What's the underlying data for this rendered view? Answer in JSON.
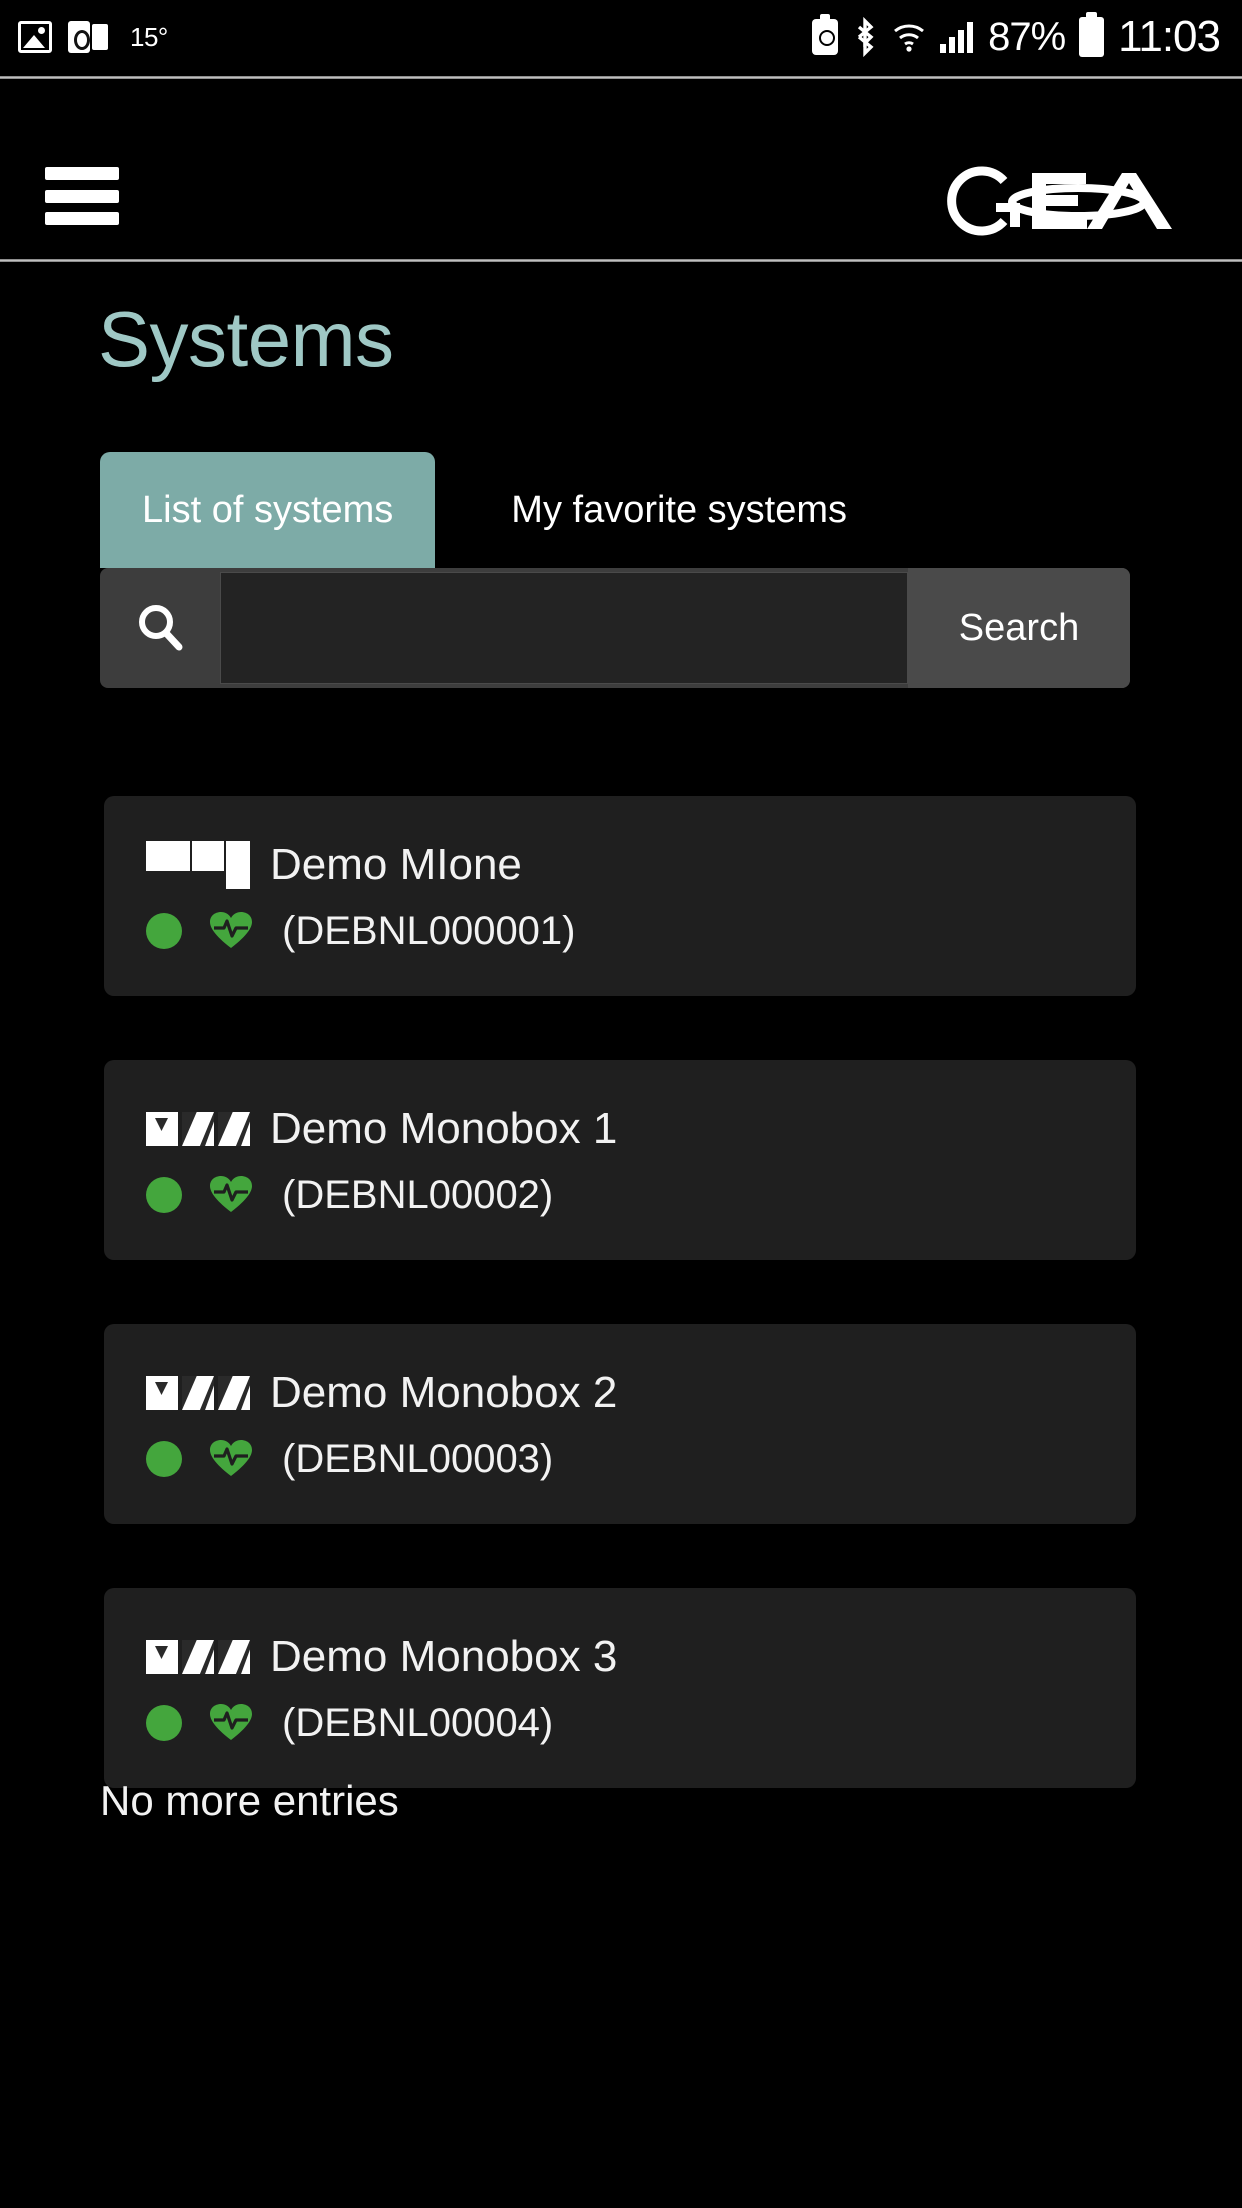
{
  "statusbar": {
    "temperature": "15°",
    "battery_percent": "87%",
    "clock": "11:03",
    "icons": {
      "photo": "photo-icon",
      "outlook": "outlook-icon",
      "battery_saver": "battery-saver-icon",
      "bluetooth": "bluetooth-icon",
      "wifi": "wifi-icon",
      "signal": "signal-bars-icon",
      "battery": "battery-icon"
    }
  },
  "appbar": {
    "menu_label": "menu",
    "logo_text": "GEA"
  },
  "page": {
    "title": "Systems"
  },
  "tabs": [
    {
      "label": "List of systems",
      "active": true
    },
    {
      "label": "My favorite systems",
      "active": false
    }
  ],
  "search": {
    "icon": "search-icon",
    "value": "",
    "placeholder": "",
    "button_label": "Search"
  },
  "systems": [
    {
      "name": "Demo MIone",
      "code": "(DEBNL000001)",
      "device_type": "mione",
      "status": "online",
      "health": "ok"
    },
    {
      "name": "Demo Monobox 1",
      "code": "(DEBNL00002)",
      "device_type": "monobox",
      "status": "online",
      "health": "ok"
    },
    {
      "name": "Demo Monobox 2",
      "code": "(DEBNL00003)",
      "device_type": "monobox",
      "status": "online",
      "health": "ok"
    },
    {
      "name": "Demo Monobox 3",
      "code": "(DEBNL00004)",
      "device_type": "monobox",
      "status": "online",
      "health": "ok"
    }
  ],
  "footer": {
    "no_more_entries": "No more entries"
  },
  "colors": {
    "accent_teal": "#7daba7",
    "title_teal": "#9fc8c5",
    "status_green": "#44a63d",
    "card_bg": "#1f1f1f",
    "page_bg": "#000000"
  }
}
